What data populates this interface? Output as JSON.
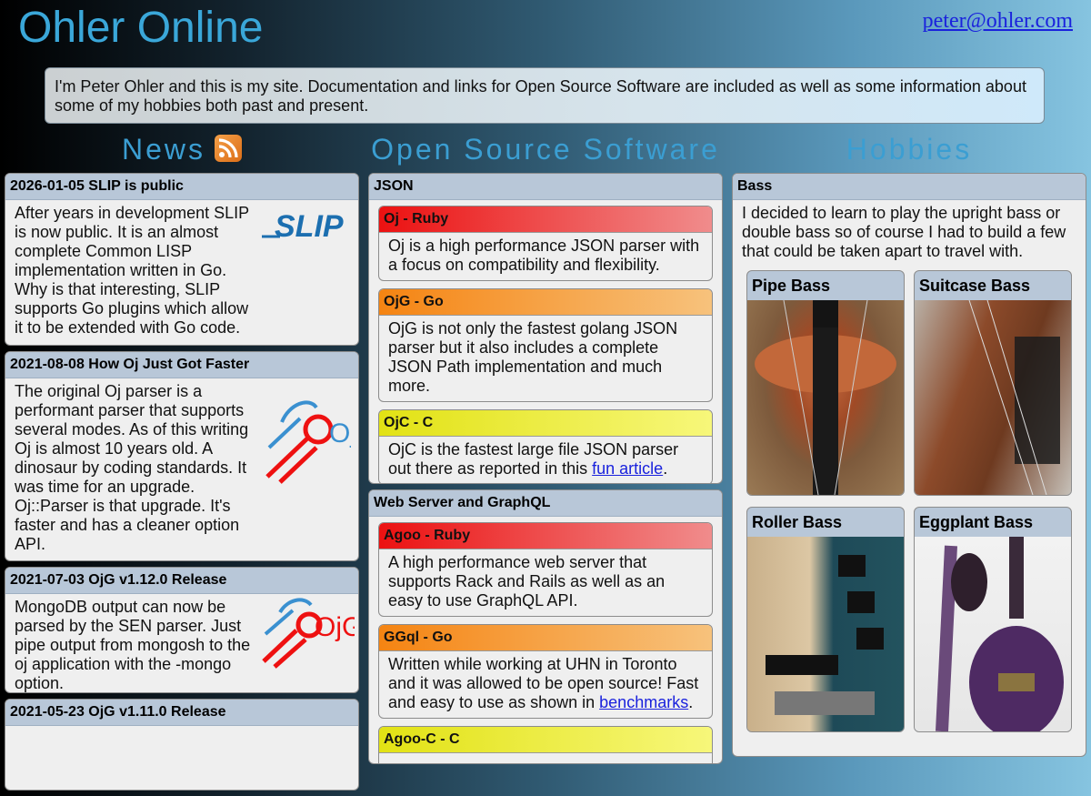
{
  "header": {
    "title": "Ohler Online",
    "email": "peter@ohler.com",
    "intro": "I'm Peter Ohler and this is my site. Documentation and links for Open Source Software are included as well as some information about some of my hobbies both past and present."
  },
  "columns": {
    "news": "News",
    "oss": "Open Source Software",
    "hobbies": "Hobbies"
  },
  "news": [
    {
      "title": "2026-01-05 SLIP is public",
      "body": "After years in development SLIP is now public. It is an almost complete Common LISP implementation written in Go. Why is that interesting, SLIP supports Go plugins which allow it to be extended with Go code.",
      "logo": "SLIP"
    },
    {
      "title": "2021-08-08 How Oj Just Got Faster",
      "body": "The original Oj parser is a performant parser that supports several modes. As of this writing Oj is almost 10 years old. A dinosaur by coding standards. It was time for an upgrade. Oj::Parser is that upgrade. It's faster and has a cleaner option API.",
      "logo": "Oj"
    },
    {
      "title": "2021-07-03 OjG v1.12.0 Release",
      "body": "MongoDB output can now be parsed by the SEN parser. Just pipe output from mongosh to the oj application with the -mongo option.",
      "logo": "OjG"
    },
    {
      "title": "2021-05-23 OjG v1.11.0 Release",
      "body": ""
    }
  ],
  "oss": {
    "json": {
      "title": "JSON",
      "items": [
        {
          "title": "Oj - Ruby",
          "body": "Oj is a high performance JSON parser with a focus on compatibility and flexibility."
        },
        {
          "title": "OjG - Go",
          "body": "OjG is not only the fastest golang JSON parser but it also includes a complete JSON Path implementation and much more."
        },
        {
          "title": "OjC - C",
          "body_pre": "OjC is the fastest large file JSON parser out there as reported in this ",
          "link": "fun article",
          "body_post": "."
        }
      ]
    },
    "web": {
      "title": "Web Server and GraphQL",
      "items": [
        {
          "title": "Agoo - Ruby",
          "body": "A high performance web server that supports Rack and Rails as well as an easy to use GraphQL API."
        },
        {
          "title": "GGql - Go",
          "body_pre": "Written while working at UHN in Toronto and it was allowed to be open source! Fast and easy to use as shown in ",
          "link": "benchmarks",
          "body_post": "."
        },
        {
          "title": "Agoo-C - C",
          "body": ""
        }
      ]
    }
  },
  "hobbies": {
    "title": "Bass",
    "body": "I decided to learn to play the upright bass or double bass so of course I had to build a few that could be taken apart to travel with.",
    "basses": [
      {
        "title": "Pipe Bass"
      },
      {
        "title": "Suitcase Bass"
      },
      {
        "title": "Roller Bass"
      },
      {
        "title": "Eggplant Bass"
      }
    ]
  },
  "colors": {
    "title": "#3aa7d9",
    "card_header": "#b8c7d8",
    "ruby": "#ec1111",
    "go": "#f58412",
    "c": "#e2e214",
    "link": "#1a22dd"
  }
}
